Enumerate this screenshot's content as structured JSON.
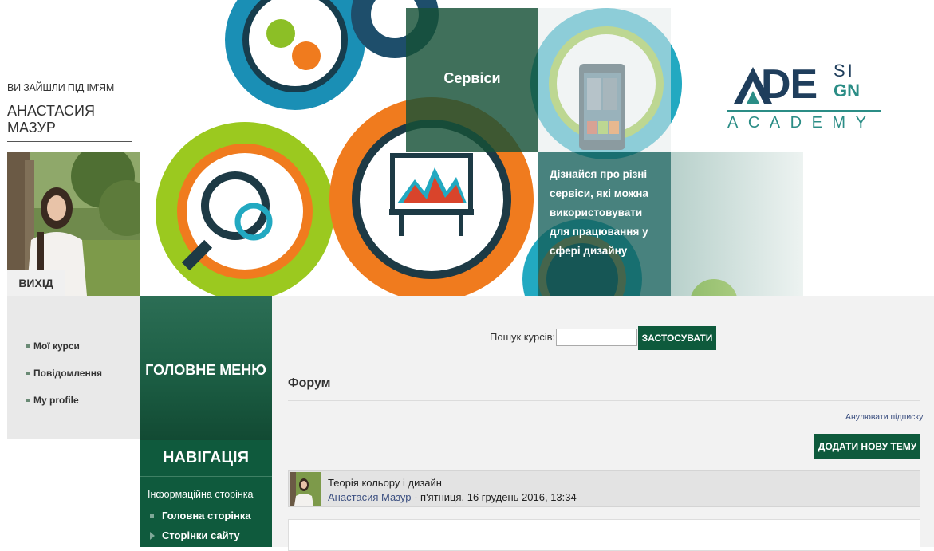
{
  "user": {
    "logged_in_label": "ВИ ЗАЙШЛИ ПІД ІМ'ЯМ",
    "name": "АНАСТАСИЯ МАЗУР",
    "logout_label": "ВИХІД"
  },
  "user_menu": [
    {
      "label": "Мої курси"
    },
    {
      "label": "Повідомлення"
    },
    {
      "label": "My profile"
    }
  ],
  "banner": {
    "services_title": "Сервіси",
    "services_description": "Дізнайся про різні сервіси, які можна використовувати для працювання у сфері дизайну"
  },
  "brand": {
    "main": "DE",
    "top_right": "SI",
    "bottom_right": "GN",
    "subtitle": "ACADEMY"
  },
  "main_menu": {
    "title": "ГОЛОВНЕ МЕНЮ"
  },
  "navigation": {
    "title": "НАВІГАЦІЯ",
    "info": "Інформаційна сторінка",
    "items": [
      {
        "label": "Головна сторінка"
      },
      {
        "label": "Сторінки сайту"
      }
    ]
  },
  "search": {
    "label": "Пошук курсів:",
    "value": "",
    "button_label": "ЗАСТОСУВАТИ"
  },
  "forum": {
    "title": "Форум",
    "unsubscribe_label": "Анулювати підписку",
    "add_topic_label": "ДОДАТИ НОВУ ТЕМУ",
    "post": {
      "subject": "Теорія кольору і дизайн",
      "author": "Анастасия Мазур",
      "date": " - п'ятниця, 16 грудень 2016, 13:34"
    }
  },
  "colors": {
    "primary_green": "#0e5a3c",
    "link_blue": "#3b4f80",
    "brand_navy": "#1f3e5c",
    "brand_teal": "#2b8d86"
  }
}
